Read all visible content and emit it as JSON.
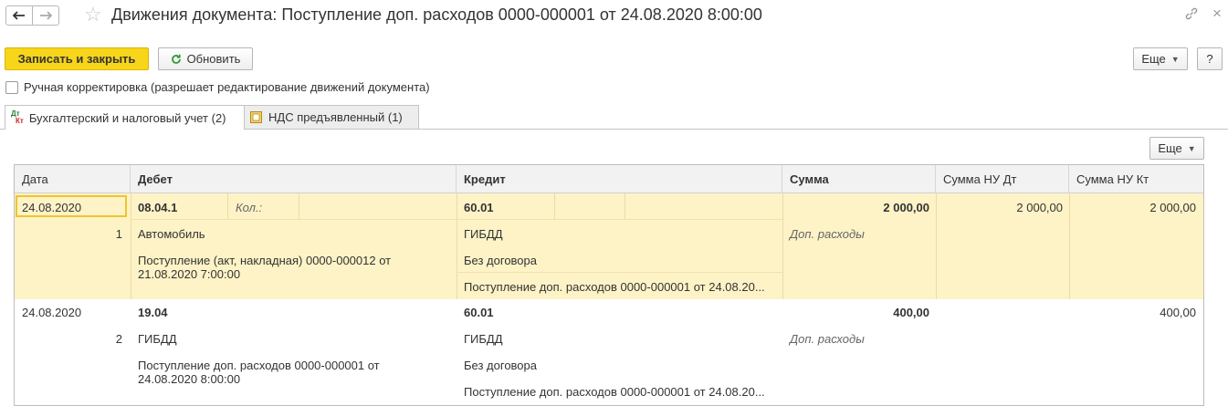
{
  "window": {
    "title": "Движения документа: Поступление доп. расходов 0000-000001 от 24.08.2020 8:00:00",
    "back_icon": "arrow-left",
    "forward_icon": "arrow-right",
    "favorite_icon": "star",
    "link_icon": "link",
    "close_icon": "close"
  },
  "toolbar": {
    "save_close_label": "Записать и закрыть",
    "refresh_label": "Обновить",
    "more_label": "Еще",
    "help_label": "?"
  },
  "manual_correction": {
    "label": "Ручная корректировка (разрешает редактирование движений документа)",
    "checked": false
  },
  "tabs": [
    {
      "label": "Бухгалтерский и налоговый учет (2)",
      "icon_top": "Дт",
      "icon_bottom": "Кт",
      "active": true
    },
    {
      "label": "НДС предъявленный (1)",
      "active": false
    }
  ],
  "table": {
    "more_label": "Еще",
    "columns": [
      "Дата",
      "Дебет",
      "Кредит",
      "Сумма",
      "Сумма НУ Дт",
      "Сумма НУ Кт"
    ],
    "rows": [
      {
        "date": "24.08.2020",
        "num": "1",
        "debit_account": "08.04.1",
        "debit_qty_label": "Кол.:",
        "debit_sub1": "Автомобиль",
        "debit_sub2": "Поступление (акт, накладная) 0000-000012 от 21.08.2020 7:00:00",
        "credit_account": "60.01",
        "credit_sub1": "ГИБДД",
        "credit_sub2": "Без договора",
        "credit_sub3": "Поступление доп. расходов 0000-000001 от 24.08.20...",
        "amount": "2 000,00",
        "amount_note": "Доп. расходы",
        "nu_dt": "2 000,00",
        "nu_kt": "2 000,00"
      },
      {
        "date": "24.08.2020",
        "num": "2",
        "debit_account": "19.04",
        "debit_sub1": "ГИБДД",
        "debit_sub2": "Поступление доп. расходов 0000-000001 от 24.08.2020 8:00:00",
        "credit_account": "60.01",
        "credit_sub1": "ГИБДД",
        "credit_sub2": "Без договора",
        "credit_sub3": "Поступление доп. расходов 0000-000001 от 24.08.20...",
        "amount": "400,00",
        "amount_note": "Доп. расходы",
        "nu_dt": "",
        "nu_kt": "400,00"
      }
    ]
  },
  "colors": {
    "primary_button": "#f7d51b",
    "selected_row": "#fdf3c6",
    "selected_cell_border": "#f0c330"
  }
}
